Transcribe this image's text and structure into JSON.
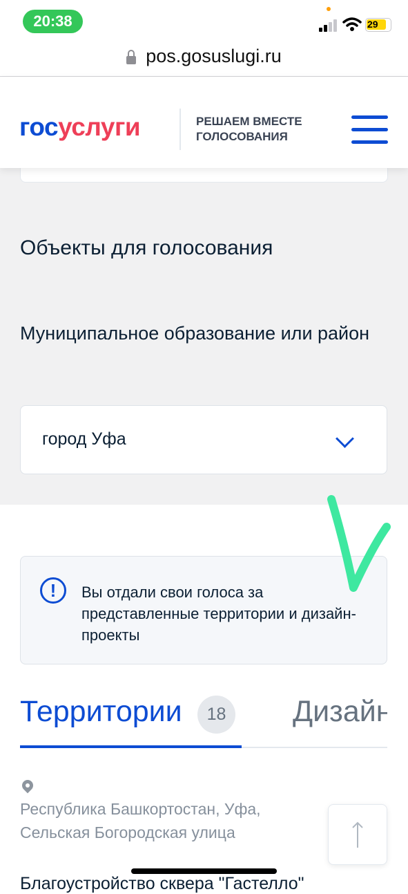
{
  "status": {
    "time": "20:38",
    "battery": "29"
  },
  "browser": {
    "url": "pos.gosuslugi.ru"
  },
  "header": {
    "logo_gos": "гос",
    "logo_uslugi": "услуги",
    "slogan": "РЕШАЕМ ВМЕСТЕ ГОЛОСОВАНИЯ"
  },
  "main": {
    "section_title": "Объекты для голосования",
    "municipality_label": "Муниципальное образование или район",
    "municipality_value": "город Уфа",
    "notice": "Вы отдали свои голоса за представленные территории и дизайн-проекты",
    "tabs": [
      {
        "label": "Территории",
        "count": "18"
      },
      {
        "label": "Дизайн"
      }
    ],
    "address": "Республика Башкортостан, Уфа, Сельская Богородская улица",
    "project_title": "Благоустройство сквера \"Гастелло\""
  },
  "colors": {
    "accent": "#0d4cd3",
    "brand_red": "#ee3f58",
    "checkmark": "#3ee8a0"
  }
}
